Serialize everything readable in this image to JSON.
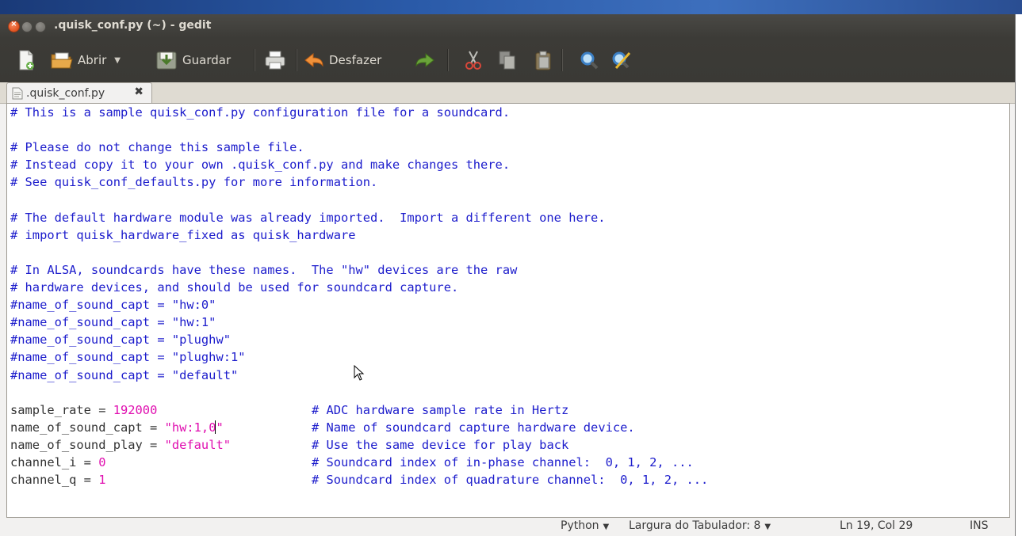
{
  "window": {
    "title": ".quisk_conf.py (~) - gedit"
  },
  "toolbar": {
    "open_label": "Abrir",
    "save_label": "Guardar",
    "undo_label": "Desfazer"
  },
  "tabs": [
    {
      "label": ".quisk_conf.py",
      "close_glyph": "✖"
    }
  ],
  "editor": {
    "lines": [
      [
        {
          "t": "# This is a sample quisk_conf.py configuration file for a soundcard.",
          "c": "comment"
        }
      ],
      [],
      [
        {
          "t": "# Please do not change this sample file.",
          "c": "comment"
        }
      ],
      [
        {
          "t": "# Instead copy it to your own .quisk_conf.py and make changes there.",
          "c": "comment"
        }
      ],
      [
        {
          "t": "# See quisk_conf_defaults.py for more information.",
          "c": "comment"
        }
      ],
      [],
      [
        {
          "t": "# The default hardware module was already imported.  Import a different one here.",
          "c": "comment"
        }
      ],
      [
        {
          "t": "# import quisk_hardware_fixed as quisk_hardware",
          "c": "comment"
        }
      ],
      [],
      [
        {
          "t": "# In ALSA, soundcards have these names.  The \"hw\" devices are the raw",
          "c": "comment"
        }
      ],
      [
        {
          "t": "# hardware devices, and should be used for soundcard capture.",
          "c": "comment"
        }
      ],
      [
        {
          "t": "#name_of_sound_capt = \"hw:0\"",
          "c": "comment"
        }
      ],
      [
        {
          "t": "#name_of_sound_capt = \"hw:1\"",
          "c": "comment"
        }
      ],
      [
        {
          "t": "#name_of_sound_capt = \"plughw\"",
          "c": "comment"
        }
      ],
      [
        {
          "t": "#name_of_sound_capt = \"plughw:1\"",
          "c": "comment"
        }
      ],
      [
        {
          "t": "#name_of_sound_capt = \"default\"",
          "c": "comment"
        }
      ],
      [],
      [
        {
          "t": "sample_rate = ",
          "c": "text"
        },
        {
          "t": "192000",
          "c": "num"
        },
        {
          "t": "                     ",
          "c": "text"
        },
        {
          "t": "# ADC hardware sample rate in Hertz",
          "c": "comment"
        }
      ],
      [
        {
          "t": "name_of_sound_capt = ",
          "c": "text"
        },
        {
          "t": "\"hw:1,0",
          "c": "str"
        },
        {
          "t": "|",
          "c": "caret"
        },
        {
          "t": "\"",
          "c": "str"
        },
        {
          "t": "            ",
          "c": "text"
        },
        {
          "t": "# Name of soundcard capture hardware device.",
          "c": "comment"
        }
      ],
      [
        {
          "t": "name_of_sound_play = ",
          "c": "text"
        },
        {
          "t": "\"default\"",
          "c": "str"
        },
        {
          "t": "           ",
          "c": "text"
        },
        {
          "t": "# Use the same device for play back",
          "c": "comment"
        }
      ],
      [
        {
          "t": "channel_i = ",
          "c": "text"
        },
        {
          "t": "0",
          "c": "num"
        },
        {
          "t": "                            ",
          "c": "text"
        },
        {
          "t": "# Soundcard index of in-phase channel:  0, 1, 2, ...",
          "c": "comment"
        }
      ],
      [
        {
          "t": "channel_q = ",
          "c": "text"
        },
        {
          "t": "1",
          "c": "num"
        },
        {
          "t": "                            ",
          "c": "text"
        },
        {
          "t": "# Soundcard index of quadrature channel:  0, 1, 2, ...",
          "c": "comment"
        }
      ]
    ]
  },
  "status": {
    "language": "Python",
    "tab_width": "Largura do Tabulador: 8",
    "position": "Ln 19, Col 29",
    "mode": "INS"
  },
  "colors": {
    "comment": "#1c1ccc",
    "literal": "#e00fb0",
    "text": "#333333",
    "chrome_dark": "#3c3b37"
  },
  "icons": [
    "new-document-icon",
    "open-folder-icon",
    "save-icon",
    "print-icon",
    "undo-icon",
    "redo-icon",
    "cut-icon",
    "copy-icon",
    "paste-icon",
    "find-icon",
    "find-replace-icon"
  ]
}
